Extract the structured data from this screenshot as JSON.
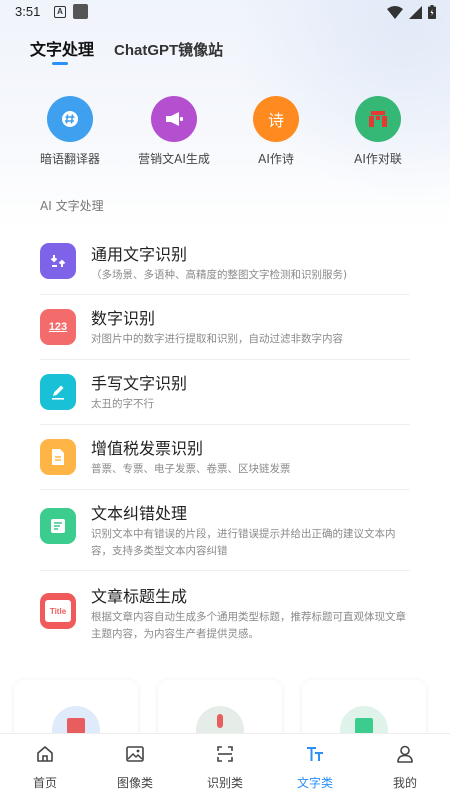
{
  "status_bar": {
    "time": "3:51"
  },
  "top_tabs": [
    {
      "label": "文字处理",
      "active": true
    },
    {
      "label": "ChatGPT镜像站",
      "active": false
    }
  ],
  "quick_tools": [
    {
      "label": "暗语翻译器",
      "icon": "hash-icon",
      "color": "#3ea0ee"
    },
    {
      "label": "营销文AI生成",
      "icon": "megaphone-icon",
      "color": "#b44fd0"
    },
    {
      "label": "AI作诗",
      "icon": "poem-icon",
      "glyph": "诗",
      "color": "#ff8a1f"
    },
    {
      "label": "AI作对联",
      "icon": "couplet-icon",
      "color": "#35b776"
    }
  ],
  "section_title": "AI 文字处理",
  "features": [
    {
      "title": "通用文字识别",
      "desc": "（多场景、多语种、高精度的整图文字检测和识别服务)",
      "icon": "text-recognition-icon",
      "color": "#7e63e8"
    },
    {
      "title": "数字识别",
      "desc": "对图片中的数字进行提取和识别，自动过滤非数字内容",
      "icon": "number-icon",
      "glyph": "123",
      "color": "#f36b6b"
    },
    {
      "title": "手写文字识别",
      "desc": "太丑的字不行",
      "icon": "pen-icon",
      "color": "#19c1d6"
    },
    {
      "title": "增值税发票识别",
      "desc": "普票、专票、电子发票、卷票、区块链发票",
      "icon": "invoice-icon",
      "color": "#ffb545"
    },
    {
      "title": "文本纠错处理",
      "desc": "识别文本中有错误的片段，进行错误提示并给出正确的建议文本内容，支持多类型文本内容纠错",
      "icon": "text-correct-icon",
      "color": "#3ccc8d"
    },
    {
      "title": "文章标题生成",
      "desc": "根据文章内容自动生成多个通用类型标题，推荐标题可直观体现文章主题内容，为内容生产者提供灵感。",
      "icon": "title-icon",
      "glyph": "Title",
      "color": "#f05a5a"
    }
  ],
  "bottom_nav": [
    {
      "label": "首页",
      "icon": "home-icon",
      "active": false
    },
    {
      "label": "图像类",
      "icon": "image-icon",
      "active": false
    },
    {
      "label": "识别类",
      "icon": "scan-icon",
      "active": false
    },
    {
      "label": "文字类",
      "icon": "text-icon",
      "active": true
    },
    {
      "label": "我的",
      "icon": "user-icon",
      "active": false
    }
  ],
  "colors": {
    "accent": "#2a8ff7"
  }
}
